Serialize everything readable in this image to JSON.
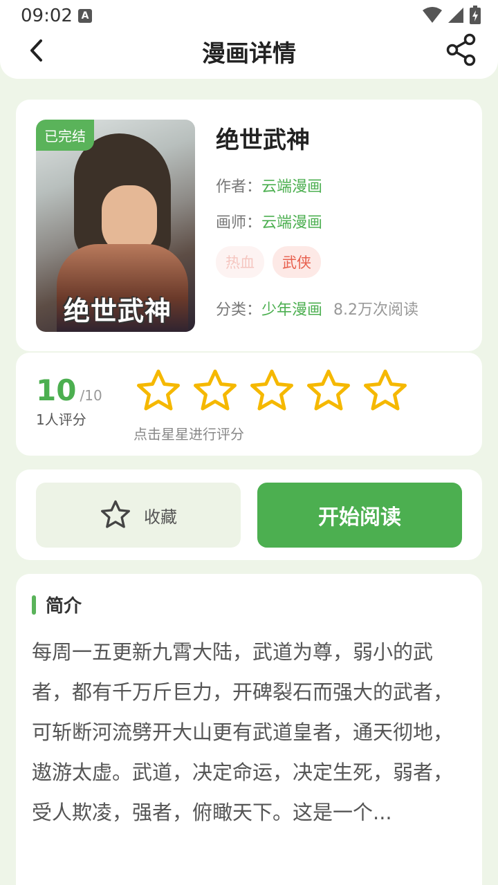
{
  "status": {
    "time": "09:02",
    "notif_letter": "A"
  },
  "header": {
    "title": "漫画详情"
  },
  "comic": {
    "status_badge": "已完结",
    "cover_text": "绝世武神",
    "title": "绝世武神",
    "author_label": "作者：",
    "author": "云端漫画",
    "artist_label": "画师：",
    "artist": "云端漫画",
    "tags": [
      "热血",
      "武侠"
    ],
    "category_label": "分类：",
    "category": "少年漫画",
    "views": "8.2万次阅读"
  },
  "rating": {
    "score": "10",
    "max": "/10",
    "count": "1人评分",
    "stars": 5,
    "hint": "点击星星进行评分"
  },
  "actions": {
    "favorite": "收藏",
    "read": "开始阅读"
  },
  "intro": {
    "heading": "简介",
    "text": "每周一五更新九霄大陆，武道为尊，弱小的武者，都有千万斤巨力，开碑裂石而强大的武者，可斩断河流劈开大山更有武道皇者，通天彻地，遨游太虚。武道，决定命运，决定生死，弱者，受人欺凌，强者，俯瞰天下。这是一个..."
  },
  "colors": {
    "accent": "#4caf50",
    "star": "#f5b800",
    "background": "#eef5e8"
  }
}
